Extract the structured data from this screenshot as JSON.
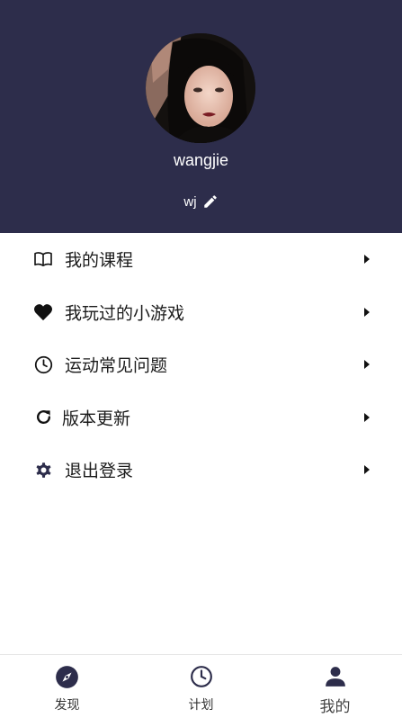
{
  "profile": {
    "username": "wangjie",
    "nickname": "wj"
  },
  "menu": {
    "items": [
      {
        "label": "我的课程",
        "icon": "open-book-icon"
      },
      {
        "label": "我玩过的小游戏",
        "icon": "heart-icon"
      },
      {
        "label": "运动常见问题",
        "icon": "clock-icon"
      },
      {
        "label": "版本更新",
        "icon": "refresh-icon"
      },
      {
        "label": "退出登录",
        "icon": "gear-icon"
      }
    ]
  },
  "tabbar": {
    "tabs": [
      {
        "label": "发现",
        "icon": "compass-icon"
      },
      {
        "label": "计划",
        "icon": "clock-icon"
      },
      {
        "label": "我的",
        "icon": "user-icon",
        "active": true
      }
    ]
  },
  "colors": {
    "header_bg": "#2d2d4b",
    "accent": "#2d2d4b"
  }
}
